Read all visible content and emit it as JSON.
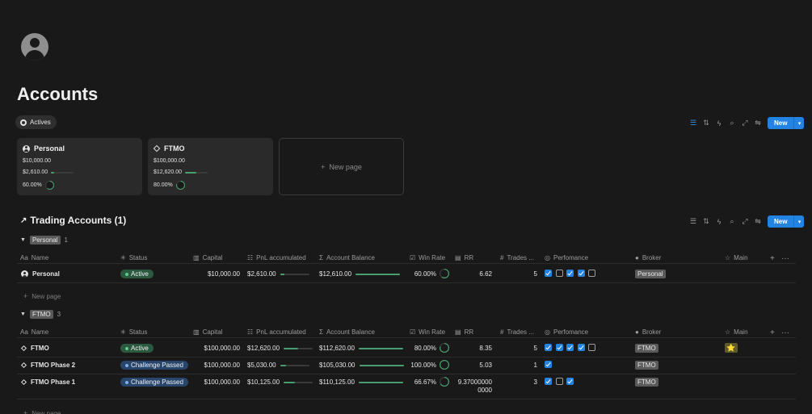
{
  "page": {
    "title": "Accounts"
  },
  "view_tab": {
    "label": "Actives"
  },
  "toolbar": {
    "new_label": "New"
  },
  "cards": [
    {
      "name": "Personal",
      "icon": "person-icon",
      "capital": "$10,000.00",
      "pnl": "$2,610.00",
      "pnl_fraction": 0.15,
      "win_rate": "60.00%",
      "win_fraction": 0.6
    },
    {
      "name": "FTMO",
      "icon": "diamond-icon",
      "capital": "$100,000.00",
      "pnl": "$12,620.00",
      "pnl_fraction": 0.5,
      "win_rate": "80.00%",
      "win_fraction": 0.8
    }
  ],
  "new_page_card": {
    "label": "New page"
  },
  "section": {
    "title": "Trading Accounts (1)"
  },
  "columns": [
    "Name",
    "Status",
    "Capital",
    "PnL accumulated",
    "Account Balance",
    "Win Rate",
    "RR",
    "Trades ...",
    "Perfomance",
    "Broker",
    "Main"
  ],
  "groups": [
    {
      "tag": "Personal",
      "count": "1",
      "rows": [
        {
          "name": "Personal",
          "icon": "person-icon",
          "status": "Active",
          "capital": "$10,000.00",
          "pnl": "$2,610.00",
          "pnl_fraction": 0.15,
          "balance": "$12,610.00",
          "balance_fraction": 1.0,
          "win_rate": "60.00%",
          "win_fraction": 0.6,
          "rr": "6.62",
          "trades": "5",
          "perf": [
            1,
            0,
            1,
            1,
            0
          ],
          "broker": "Personal",
          "main": ""
        }
      ],
      "new_label": "New page"
    },
    {
      "tag": "FTMO",
      "count": "3",
      "rows": [
        {
          "name": "FTMO",
          "icon": "diamond-icon",
          "status": "Active",
          "capital": "$100,000.00",
          "pnl": "$12,620.00",
          "pnl_fraction": 0.5,
          "balance": "$112,620.00",
          "balance_fraction": 1.0,
          "win_rate": "80.00%",
          "win_fraction": 0.8,
          "rr": "8.35",
          "trades": "5",
          "perf": [
            1,
            1,
            1,
            1,
            0
          ],
          "broker": "FTMO",
          "main": "⭐"
        },
        {
          "name": "FTMO Phase 2",
          "icon": "diamond-icon",
          "status": "Challenge Passed",
          "capital": "$100,000.00",
          "pnl": "$5,030.00",
          "pnl_fraction": 0.2,
          "balance": "$105,030.00",
          "balance_fraction": 1.0,
          "win_rate": "100.00%",
          "win_fraction": 1.0,
          "rr": "5.03",
          "trades": "1",
          "perf": [
            1
          ],
          "broker": "FTMO",
          "main": ""
        },
        {
          "name": "FTMO Phase 1",
          "icon": "diamond-icon",
          "status": "Challenge Passed",
          "capital": "$100,000.00",
          "pnl": "$10,125.00",
          "pnl_fraction": 0.4,
          "balance": "$110,125.00",
          "balance_fraction": 1.0,
          "win_rate": "66.67%",
          "win_fraction": 0.6667,
          "rr_line1": "9.37000000",
          "rr_line2": "0000",
          "trades": "3",
          "perf": [
            1,
            0,
            1
          ],
          "broker": "FTMO",
          "main": ""
        }
      ],
      "new_label": "New page"
    }
  ],
  "colors": {
    "active": "#2b593f",
    "active_dot": "#5fc98a",
    "challenge": "#28456c",
    "challenge_dot": "#7fb0e8",
    "accent": "#2383e2",
    "ring": "#4a9d6e"
  }
}
